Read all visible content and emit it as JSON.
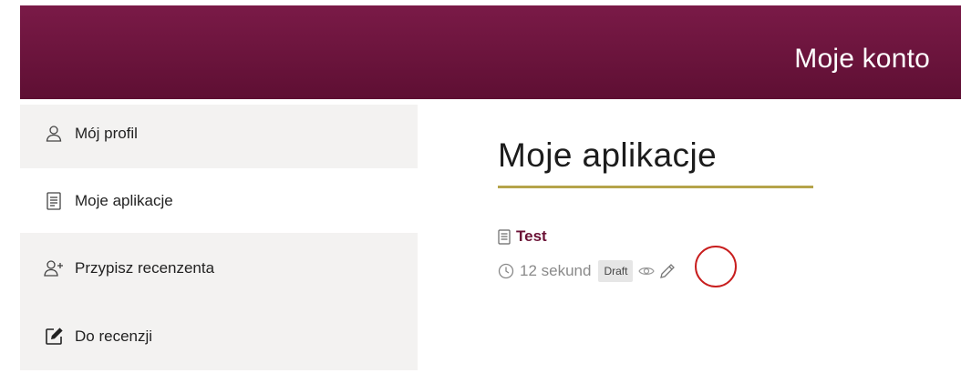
{
  "header": {
    "title": "Moje konto"
  },
  "sidebar": {
    "items": [
      {
        "label": "Mój profil",
        "icon": "user-icon"
      },
      {
        "label": "Moje aplikacje",
        "icon": "document-icon"
      },
      {
        "label": "Przypisz recenzenta",
        "icon": "add-user-icon"
      },
      {
        "label": "Do recenzji",
        "icon": "edit-square-icon"
      }
    ],
    "active_index": 1
  },
  "main": {
    "title": "Moje aplikacje",
    "applications": [
      {
        "name": "Test",
        "time": "12 sekund",
        "status": "Draft"
      }
    ]
  },
  "colors": {
    "header_bg": "#6b1439",
    "accent_underline": "#b5a44a",
    "app_link": "#6b1236",
    "highlight": "#c81e1e"
  }
}
